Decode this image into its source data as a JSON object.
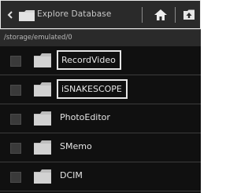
{
  "toolbar": {
    "title": "Explore Database",
    "back_icon": "chevron-left-icon",
    "app_icon": "folder-icon",
    "home_icon": "home-icon",
    "up_icon": "folder-up-icon"
  },
  "path": "/storage/emulated/0",
  "folders": [
    {
      "name": "RecordVideo",
      "highlighted": true
    },
    {
      "name": "iSNAKESCOPE",
      "highlighted": true
    },
    {
      "name": "PhotoEditor",
      "highlighted": false
    },
    {
      "name": "SMemo",
      "highlighted": false
    },
    {
      "name": "DCIM",
      "highlighted": false
    }
  ],
  "colors": {
    "background": "#101010",
    "bar": "#2a2a2a",
    "folder": "#cfcfcf",
    "text": "#e4e4e4",
    "highlight_border": "#e6e6e6"
  }
}
